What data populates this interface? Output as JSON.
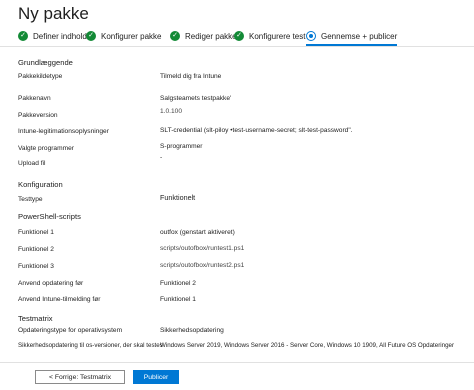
{
  "title": "Ny pakke",
  "steps": [
    {
      "label": "Definer indhold",
      "state": "done"
    },
    {
      "label": "Konfigurer pakke",
      "state": "done"
    },
    {
      "label": "Rediger pakke",
      "state": "done"
    },
    {
      "label": "Konfigurere test",
      "state": "done"
    },
    {
      "label": "Gennemse + publicer",
      "state": "active"
    }
  ],
  "sections": {
    "basics": "Grundlæggende",
    "configuration": "Konfiguration",
    "powershell": "PowerShell-scripts",
    "testmatrix": "Testmatrix"
  },
  "basics": {
    "package_source_type_label": "Pakkekildetype",
    "package_source_type_value": "Tilmeld dig fra Intune",
    "package_name_label": "Pakkenavn",
    "package_name_value": "Salgsteamets testpakke'",
    "package_version_label": "Pakkeversion",
    "package_version_value": "1.0.100",
    "intune_credentials_label": "Intune-legitimationsoplysninger",
    "intune_credentials_value": "SLT-credential (slt-piloy •test-username-secret; slt-test-password\".",
    "selected_programs_label": "Valgte programmer",
    "selected_programs_value": "S-programmer",
    "upload_file_label": "Upload fil",
    "upload_file_value": "-"
  },
  "configuration": {
    "test_type_label": "Testtype",
    "test_type_value": "Funktionelt"
  },
  "powershell": {
    "f1_label": "Funktionel 1",
    "f1_value": "outfox (genstart aktiveret)",
    "f2_label": "Funktionel 2",
    "f2_value": "scripts/outofbox/runtest1.ps1",
    "f3_label": "Funktionel 3",
    "f3_value": "scripts/outofbox/runtest2.ps1",
    "apply_update_label": "Anvend opdatering før",
    "apply_update_value": "Funktionel 2",
    "apply_intune_label": "Anvend Intune-tilmelding før",
    "apply_intune_value": "Funktionel 1"
  },
  "testmatrix": {
    "os_update_type_label": "Opdateringstype for operativsystem",
    "os_update_type_value": "Sikkerhedsopdatering",
    "security_update_label": "Sikkerhedsopdatering til os-versioner, der skal testes",
    "security_update_value": "Windows Server 2019, Windows Server 2016 - Server Core, Windows 10 1909, All Future OS Opdateringer"
  },
  "footer": {
    "prev_label": "< Forrige: Testmatrix",
    "publish_label": "Publicer"
  }
}
